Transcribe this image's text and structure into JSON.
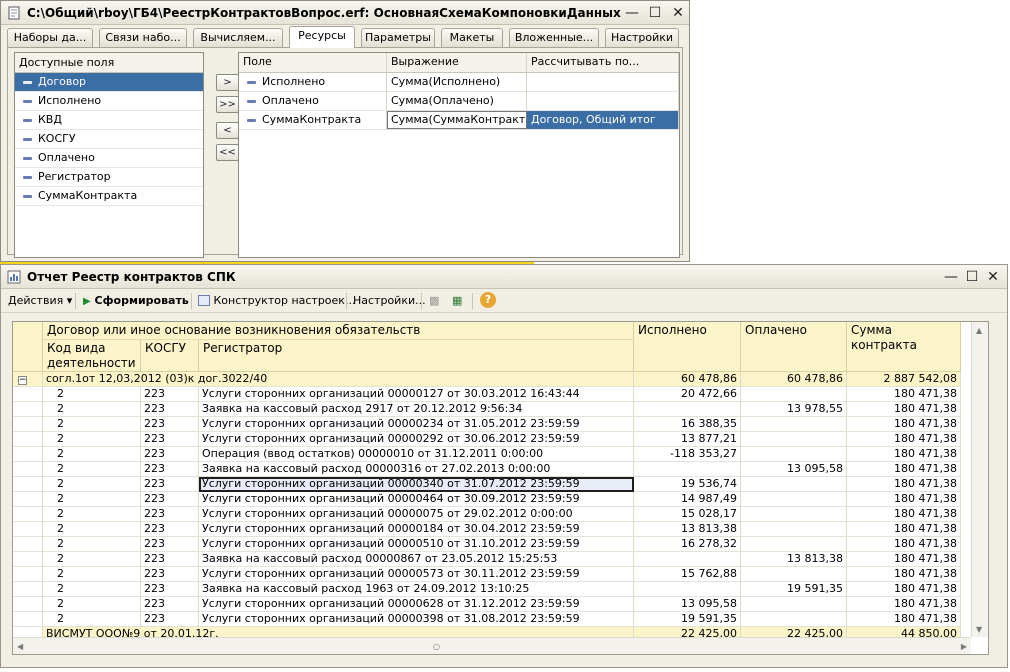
{
  "win1": {
    "title": "C:\\Общий\\rboy\\ГБ4\\РеестрКонтрактовВопрос.erf: ОсновнаяСхемаКомпоновкиДанных",
    "tabs": [
      "Наборы да...",
      "Связи набо...",
      "Вычисляем...",
      "Ресурсы",
      "Параметры",
      "Макеты",
      "Вложенные...",
      "Настройки"
    ],
    "active_tab": "Ресурсы",
    "available_header": "Доступные поля",
    "available_fields": [
      "Договор",
      "Исполнено",
      "КВД",
      "КОСГУ",
      "Оплачено",
      "Регистратор",
      "СуммаКонтракта"
    ],
    "selected_available": "Договор",
    "move_buttons": [
      ">",
      ">>",
      "<",
      "<<"
    ],
    "resources_headers": [
      "Поле",
      "Выражение",
      "Рассчитывать по..."
    ],
    "resources_rows": [
      {
        "field": "Исполнено",
        "expr": "Сумма(Исполнено)",
        "calc": ""
      },
      {
        "field": "Оплачено",
        "expr": "Сумма(Оплачено)",
        "calc": ""
      },
      {
        "field": "СуммаКонтракта",
        "expr": "Сумма(СуммаКонтракта)",
        "calc": "Договор, Общий итог"
      }
    ]
  },
  "win2": {
    "title": "Отчет  Реестр контрактов СПК",
    "toolbar": {
      "actions": "Действия",
      "generate": "Сформировать",
      "constructor": "Конструктор настроек...",
      "settings": "Настройки..."
    },
    "header": {
      "contract": "Договор или иное основание возникновения обязательств",
      "kvd": "Код вида деятельности",
      "kosgu": "КОСГУ",
      "registrar": "Регистратор",
      "executed": "Исполнено",
      "paid": "Оплачено",
      "sum": "Сумма контракта"
    },
    "group": {
      "label": "согл.1от 12,03,2012 (03)к дог.3022/40",
      "executed": "60 478,86",
      "paid": "60 478,86",
      "sum": "2 887 542,08"
    },
    "rows": [
      {
        "kvd": "2",
        "kosgu": "223",
        "reg": "Услуги сторонних организаций 00000127 от 30.03.2012 16:43:44",
        "exec": "20 472,66",
        "paid": "",
        "sum": "180 471,38"
      },
      {
        "kvd": "2",
        "kosgu": "223",
        "reg": "Заявка на кассовый расход 2917 от 20.12.2012 9:56:34",
        "exec": "",
        "paid": "13 978,55",
        "sum": "180 471,38"
      },
      {
        "kvd": "2",
        "kosgu": "223",
        "reg": "Услуги сторонних организаций 00000234 от 31.05.2012 23:59:59",
        "exec": "16 388,35",
        "paid": "",
        "sum": "180 471,38"
      },
      {
        "kvd": "2",
        "kosgu": "223",
        "reg": "Услуги сторонних организаций 00000292 от 30.06.2012 23:59:59",
        "exec": "13 877,21",
        "paid": "",
        "sum": "180 471,38"
      },
      {
        "kvd": "2",
        "kosgu": "223",
        "reg": "Операция (ввод остатков) 00000010 от 31.12.2011 0:00:00",
        "exec": "-118 353,27",
        "paid": "",
        "sum": "180 471,38"
      },
      {
        "kvd": "2",
        "kosgu": "223",
        "reg": "Заявка на кассовый расход 00000316 от 27.02.2013 0:00:00",
        "exec": "",
        "paid": "13 095,58",
        "sum": "180 471,38"
      },
      {
        "kvd": "2",
        "kosgu": "223",
        "reg": "Услуги сторонних организаций 00000340 от 31.07.2012 23:59:59",
        "exec": "19 536,74",
        "paid": "",
        "sum": "180 471,38"
      },
      {
        "kvd": "2",
        "kosgu": "223",
        "reg": "Услуги сторонних организаций 00000464 от 30.09.2012 23:59:59",
        "exec": "14 987,49",
        "paid": "",
        "sum": "180 471,38"
      },
      {
        "kvd": "2",
        "kosgu": "223",
        "reg": "Услуги сторонних организаций 00000075 от 29.02.2012 0:00:00",
        "exec": "15 028,17",
        "paid": "",
        "sum": "180 471,38"
      },
      {
        "kvd": "2",
        "kosgu": "223",
        "reg": "Услуги сторонних организаций 00000184 от 30.04.2012 23:59:59",
        "exec": "13 813,38",
        "paid": "",
        "sum": "180 471,38"
      },
      {
        "kvd": "2",
        "kosgu": "223",
        "reg": "Услуги сторонних организаций 00000510 от 31.10.2012 23:59:59",
        "exec": "16 278,32",
        "paid": "",
        "sum": "180 471,38"
      },
      {
        "kvd": "2",
        "kosgu": "223",
        "reg": "Заявка на кассовый расход 00000867 от 23.05.2012 15:25:53",
        "exec": "",
        "paid": "13 813,38",
        "sum": "180 471,38"
      },
      {
        "kvd": "2",
        "kosgu": "223",
        "reg": "Услуги сторонних организаций 00000573 от 30.11.2012 23:59:59",
        "exec": "15 762,88",
        "paid": "",
        "sum": "180 471,38"
      },
      {
        "kvd": "2",
        "kosgu": "223",
        "reg": "Заявка на кассовый расход 1963 от 24.09.2012 13:10:25",
        "exec": "",
        "paid": "19 591,35",
        "sum": "180 471,38"
      },
      {
        "kvd": "2",
        "kosgu": "223",
        "reg": "Услуги сторонних организаций 00000628 от 31.12.2012 23:59:59",
        "exec": "13 095,58",
        "paid": "",
        "sum": "180 471,38"
      },
      {
        "kvd": "2",
        "kosgu": "223",
        "reg": "Услуги сторонних организаций 00000398 от 31.08.2012 23:59:59",
        "exec": "19 591,35",
        "paid": "",
        "sum": "180 471,38"
      }
    ],
    "selected_row_index": 6,
    "tail": {
      "label": "ВИСМУТ ООО№9 от 20.01.12г.",
      "exec": "22 425,00",
      "paid": "22 425,00",
      "sum": "44 850,00"
    }
  }
}
